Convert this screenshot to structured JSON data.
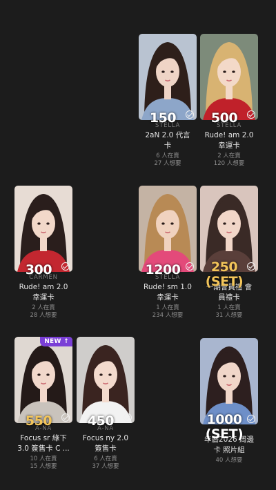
{
  "cards": [
    {
      "id": "c1",
      "price": "150",
      "member": "STELLA",
      "name": "2aN 2.0 代言\n卡",
      "selling": "6 人在賣",
      "wanting": "27 人想要",
      "hair": "#2e1f1a",
      "skin": "#efd4c6",
      "bg": "#b9c3d1",
      "cloth": "#8da6c9",
      "gold": false,
      "badge": ""
    },
    {
      "id": "c2",
      "price": "500",
      "member": "STELLA",
      "name": "Rude! am 2.0\n幸運卡",
      "selling": "2 人在賣",
      "wanting": "120 人想要",
      "hair": "#d8b372",
      "skin": "#f3d9c8",
      "bg": "#7d8b7a",
      "cloth": "#c0212a",
      "gold": false,
      "badge": ""
    },
    {
      "id": "c3",
      "price": "300",
      "member": "CARMEN",
      "name": "Rude! am 2.0\n幸運卡",
      "selling": "2 人在賣",
      "wanting": "28 人想要",
      "hair": "#2a1e1c",
      "skin": "#f2d8c9",
      "bg": "#e7dcd4",
      "cloth": "#c32730",
      "gold": false,
      "badge": ""
    },
    {
      "id": "c4",
      "price": "1200",
      "member": "STELLA",
      "name": "Rude! sm 1.0\n幸運卡",
      "selling": "1 人在賣",
      "wanting": "234 人想要",
      "hair": "#b88a55",
      "skin": "#f0d2bf",
      "bg": "#c4b3a4",
      "cloth": "#e34a7a",
      "gold": false,
      "badge": ""
    },
    {
      "id": "c5",
      "price": "250\n(SET)",
      "member": "",
      "name": "一期會員禮 會\n員禮卡",
      "selling": "1 人在賣",
      "wanting": "31 人想要",
      "hair": "#3a2a26",
      "skin": "#f1d6c8",
      "bg": "#d9c5bd",
      "cloth": "#5a3f3a",
      "gold": true,
      "badge": ""
    },
    {
      "id": "c6",
      "price": "550",
      "member": "A-NA",
      "name": "Focus sr 綠下\n3.0 簽售卡 C ...",
      "selling": "10 人在賣",
      "wanting": "15 人想要",
      "hair": "#241a18",
      "skin": "#f1d8cb",
      "bg": "#dfd8d2",
      "cloth": "#c9c3bc",
      "gold": true,
      "badge": "NEW ↑"
    },
    {
      "id": "c7",
      "price": "450",
      "member": "A-NA",
      "name": "Focus ny 2.0\n簽售卡",
      "selling": "6 人在賣",
      "wanting": "37 人想要",
      "hair": "#3a2420",
      "skin": "#f3dacd",
      "bg": "#cfcdcb",
      "cloth": "#f2f2f2",
      "gold": false,
      "badge": ""
    },
    {
      "id": "c8",
      "price": "1000\n(SET)",
      "member": "",
      "name": "年曆2026 周邊\n卡 照片組",
      "selling": "",
      "wanting": "40 人想要",
      "hair": "#2d1f1f",
      "skin": "#f0d6c9",
      "bg": "#a9b6cf",
      "cloth": "#6e8fc8",
      "gold": false,
      "badge": ""
    }
  ]
}
